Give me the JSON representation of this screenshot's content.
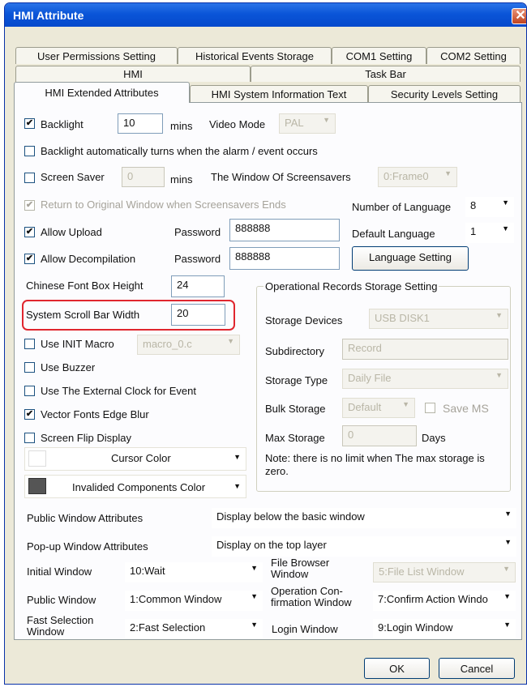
{
  "window": {
    "title": "HMI Attribute",
    "close": "✕"
  },
  "tabs": {
    "row1": [
      "User Permissions Setting",
      "Historical Events Storage",
      "COM1 Setting",
      "COM2 Setting"
    ],
    "row2": [
      "HMI",
      "Task Bar"
    ],
    "row3": [
      "HMI Extended Attributes",
      "HMI System Information Text",
      "Security Levels Setting"
    ]
  },
  "backlight": {
    "label": "Backlight",
    "value": "10",
    "unit": "mins",
    "video_label": "Video Mode",
    "video_value": "PAL"
  },
  "backlight_alarm": {
    "label": "Backlight automatically turns when the alarm / event occurs"
  },
  "screensaver": {
    "label": "Screen Saver",
    "value": "0",
    "unit": "mins",
    "window_label": "The Window Of Screensavers",
    "window_value": "0:Frame0"
  },
  "return_original": {
    "label": "Return to Original Window when Screensavers Ends"
  },
  "languages": {
    "number_label": "Number of Language",
    "number_value": "8",
    "default_label": "Default Language",
    "default_value": "1",
    "button": "Language Setting"
  },
  "upload": {
    "label": "Allow Upload",
    "password_label": "Password",
    "password": "888888"
  },
  "decompile": {
    "label": "Allow Decompilation",
    "password_label": "Password",
    "password": "888888"
  },
  "chinese_font": {
    "label": "Chinese Font Box Height",
    "value": "24"
  },
  "scroll_bar": {
    "label": "System Scroll Bar Width",
    "value": "20"
  },
  "init_macro": {
    "label": "Use INIT Macro",
    "value": "macro_0.c"
  },
  "buzzer": {
    "label": "Use Buzzer"
  },
  "external_clock": {
    "label": "Use The External Clock for Event"
  },
  "vector_fonts": {
    "label": "Vector Fonts Edge Blur"
  },
  "screen_flip": {
    "label": "Screen Flip Display"
  },
  "cursor_color": {
    "label": "Cursor Color",
    "swatch": "#ffffff"
  },
  "invalided_color": {
    "label": "Invalided Components Color",
    "swatch": "#555555"
  },
  "storage": {
    "title": "Operational Records Storage Setting",
    "devices_label": "Storage Devices",
    "devices_value": "USB DISK1",
    "subdir_label": "Subdirectory",
    "subdir_value": "Record",
    "type_label": "Storage Type",
    "type_value": "Daily File",
    "bulk_label": "Bulk Storage",
    "bulk_value": "Default",
    "save_ms": "Save MS",
    "max_label": "Max Storage",
    "max_value": "0",
    "days": "Days",
    "note": "Note: there is no limit when The max storage is zero."
  },
  "public_attr": {
    "label": "Public Window Attributes",
    "value": "Display below the basic window"
  },
  "popup_attr": {
    "label": "Pop-up Window Attributes",
    "value": "Display on the top layer"
  },
  "initial_window": {
    "label": "Initial Window",
    "value": "10:Wait"
  },
  "file_browser": {
    "label1": "File Browser",
    "label2": "Window",
    "value": "5:File List Window"
  },
  "public_window": {
    "label": "Public Window",
    "value": "1:Common Window"
  },
  "op_confirm": {
    "label1": "Operation Con-",
    "label2": "firmation Window",
    "value": "7:Confirm Action Windo"
  },
  "fast_selection": {
    "label1": "Fast Selection",
    "label2": "Window",
    "value": "2:Fast Selection"
  },
  "login_window": {
    "label": "Login Window",
    "value": "9:Login Window"
  },
  "buttons": {
    "ok": "OK",
    "cancel": "Cancel"
  }
}
